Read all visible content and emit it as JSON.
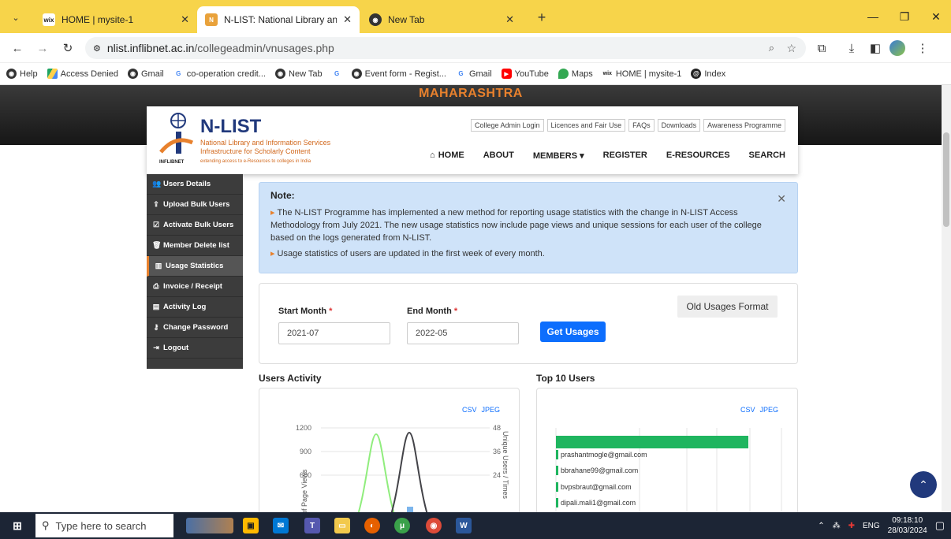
{
  "browser": {
    "tabs": [
      {
        "label": "HOME | mysite-1",
        "favicon": "wix-icon",
        "active": false
      },
      {
        "label": "N-LIST: National Library and Inf",
        "favicon": "nlist-icon",
        "active": true
      },
      {
        "label": "New Tab",
        "favicon": "chrome-icon",
        "active": false
      }
    ],
    "new_tab": "+",
    "url_host": "nlist.inflibnet.ac.in",
    "url_path": "/collegeadmin/vnusages.php",
    "bookmarks": [
      {
        "label": "Help",
        "icon": "chrome-icon"
      },
      {
        "label": "Access Denied",
        "icon": "drive-icon"
      },
      {
        "label": "Gmail",
        "icon": "chrome-icon"
      },
      {
        "label": "co-operation credit...",
        "icon": "google-icon"
      },
      {
        "label": "New Tab",
        "icon": "chrome-icon"
      },
      {
        "label": "",
        "icon": "google-icon"
      },
      {
        "label": "Event form - Regist...",
        "icon": "chrome-icon"
      },
      {
        "label": "Gmail",
        "icon": "google-icon"
      },
      {
        "label": "YouTube",
        "icon": "youtube-icon"
      },
      {
        "label": "Maps",
        "icon": "maps-icon"
      },
      {
        "label": "HOME | mysite-1",
        "icon": "wix-icon"
      },
      {
        "label": "Index",
        "icon": "index-icon"
      }
    ]
  },
  "site": {
    "state": "MAHARASHTRA",
    "logo_title": "N-LIST",
    "logo_sub1": "National Library and Information Services",
    "logo_sub2": "Infrastructure for Scholarly Content",
    "logo_sub3": "extending access to e-Resources to colleges in India",
    "logo_org": "INFLIBNET",
    "top_links": [
      "College Admin Login",
      "Licences and Fair Use",
      "FAQs",
      "Downloads",
      "Awareness Programme"
    ],
    "nav": [
      "HOME",
      "ABOUT",
      "MEMBERS ▾",
      "REGISTER",
      "E-RESOURCES",
      "SEARCH"
    ]
  },
  "sidebar": {
    "items": [
      {
        "label": "Users Details",
        "icon": "users-icon"
      },
      {
        "label": "Upload Bulk Users",
        "icon": "upload-icon"
      },
      {
        "label": "Activate Bulk Users",
        "icon": "check-icon"
      },
      {
        "label": "Member Delete list",
        "icon": "trash-icon"
      },
      {
        "label": "Usage Statistics",
        "icon": "bar-chart-icon",
        "active": true
      },
      {
        "label": "Invoice / Receipt",
        "icon": "print-icon"
      },
      {
        "label": "Activity Log",
        "icon": "log-icon"
      },
      {
        "label": "Change Password",
        "icon": "key-icon"
      },
      {
        "label": "Logout",
        "icon": "logout-icon"
      }
    ]
  },
  "note": {
    "title": "Note:",
    "p1": "The N-LIST Programme has implemented a new method for reporting usage statistics with the change in N-LIST Access Methodology from July 2021. The new usage statistics now include page views and unique sessions for each user of the college based on the logs generated from N-LIST.",
    "p2": "Usage statistics of users are updated in the first week of every month."
  },
  "form": {
    "start_label": "Start Month",
    "end_label": "End Month",
    "start_value": "2021-07",
    "end_value": "2022-05",
    "submit": "Get Usages",
    "old_format": "Old Usages Format"
  },
  "charts": {
    "activity_title": "Users Activity",
    "top_title": "Top 10 Users",
    "csv": "CSV",
    "jpeg": "JPEG"
  },
  "chart_data": [
    {
      "type": "line",
      "title": "Users Activity",
      "ylabel": "of Page Views",
      "y2label": "Unique Users / Times",
      "yticks": [
        600,
        900,
        1200
      ],
      "y2ticks": [
        24,
        36,
        48
      ],
      "ylim": [
        0,
        1200
      ],
      "y2lim": [
        0,
        48
      ],
      "series": [
        {
          "values": [
            0,
            1120,
            0
          ],
          "color": "#90ed7d"
        },
        {
          "values": [
            0,
            1140,
            0
          ],
          "color": "#434348"
        }
      ]
    },
    {
      "type": "bar",
      "title": "Top 10 Users",
      "categories": [
        "prashantmogle@gmail.com",
        "bbrahane99@gmail.com",
        "bvpsbraut@gmail.com",
        "dipali.mali1@gmail.com"
      ],
      "highlight_value": 1,
      "bar_color": "#1fb55f"
    }
  ],
  "taskbar": {
    "search_placeholder": "Type here to search",
    "lang": "ENG",
    "time": "09:18:10",
    "date": "28/03/2024"
  }
}
